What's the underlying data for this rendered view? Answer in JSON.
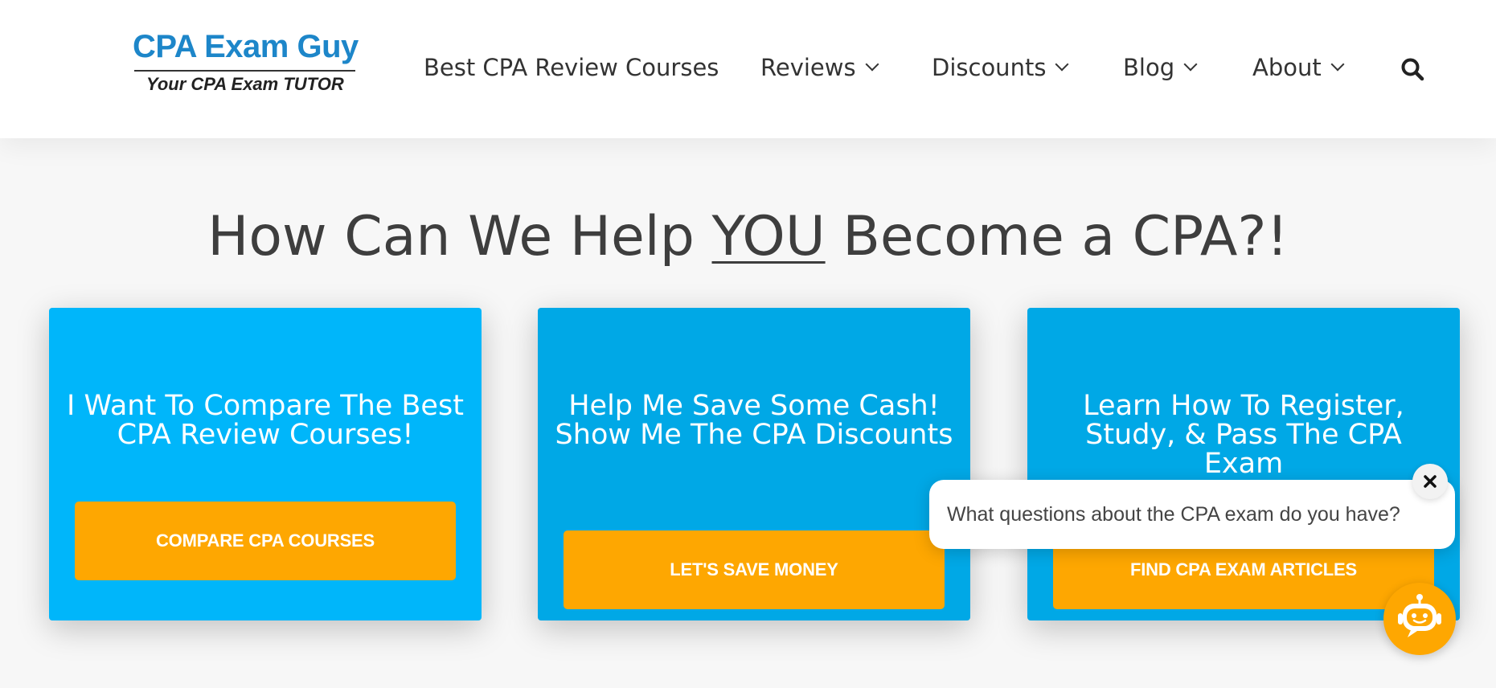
{
  "logo": {
    "title": "CPA Exam Guy",
    "tagline": "Your CPA Exam TUTOR",
    "title_color": "#1d86c9"
  },
  "nav": {
    "items": [
      {
        "label": "Best CPA Review Courses",
        "has_dropdown": false
      },
      {
        "label": "Reviews",
        "has_dropdown": true
      },
      {
        "label": "Discounts",
        "has_dropdown": true
      },
      {
        "label": "Blog",
        "has_dropdown": true
      },
      {
        "label": "About",
        "has_dropdown": true
      }
    ],
    "search_icon": "search-icon"
  },
  "hero": {
    "title_before": "How Can We Help ",
    "title_emphasis": "YOU",
    "title_after": " Become a CPA?!"
  },
  "cards": [
    {
      "heading": "I Want To Compare The Best CPA Review Courses!",
      "button": "COMPARE CPA COURSES",
      "bg": "#00b6fa"
    },
    {
      "heading": "Help Me Save Some Cash! Show Me The CPA Discounts",
      "button": "LET'S SAVE MONEY",
      "bg": "#00a8e6"
    },
    {
      "heading": "Learn How To Register, Study, & Pass The CPA Exam",
      "button": "FIND CPA EXAM ARTICLES",
      "bg": "#00a8e6"
    }
  ],
  "colors": {
    "button_orange": "#fea701",
    "text_dark": "#3e3e3e"
  },
  "chat": {
    "message": "What questions about the CPA exam do you have?",
    "close_icon": "close-icon",
    "launcher_icon": "chatbot-icon"
  }
}
